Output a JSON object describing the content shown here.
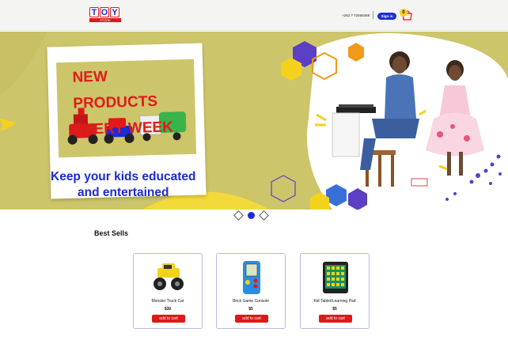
{
  "header": {
    "logo_text": "TOY",
    "logo_sub": "STORE",
    "phone": "+263 7 72566468",
    "signin_label": "Sign in",
    "cart_count": "0"
  },
  "hero": {
    "headline_line1": "NEW PRODUCTS",
    "headline_line2": "EVERY WEEK",
    "tagline_line1": "Keep your kids educated",
    "tagline_line2": "and entertained",
    "bg_color": "#cdc56a",
    "accent_blue": "#1b2bd6",
    "accent_red": "#e11b1b"
  },
  "carousel": {
    "slides": 3,
    "active_index": 1
  },
  "best_sells": {
    "title": "Best Sells",
    "products": [
      {
        "name": "Monster Truck Car",
        "price": "$30",
        "button": "add to cart",
        "icon": "monster-truck-icon"
      },
      {
        "name": "Brick Game Console",
        "price": "$5",
        "button": "add to cart",
        "icon": "game-console-icon"
      },
      {
        "name": "Kid Tablet/Learning Pad",
        "price": "$5",
        "button": "add to cart",
        "icon": "tablet-icon"
      }
    ]
  }
}
